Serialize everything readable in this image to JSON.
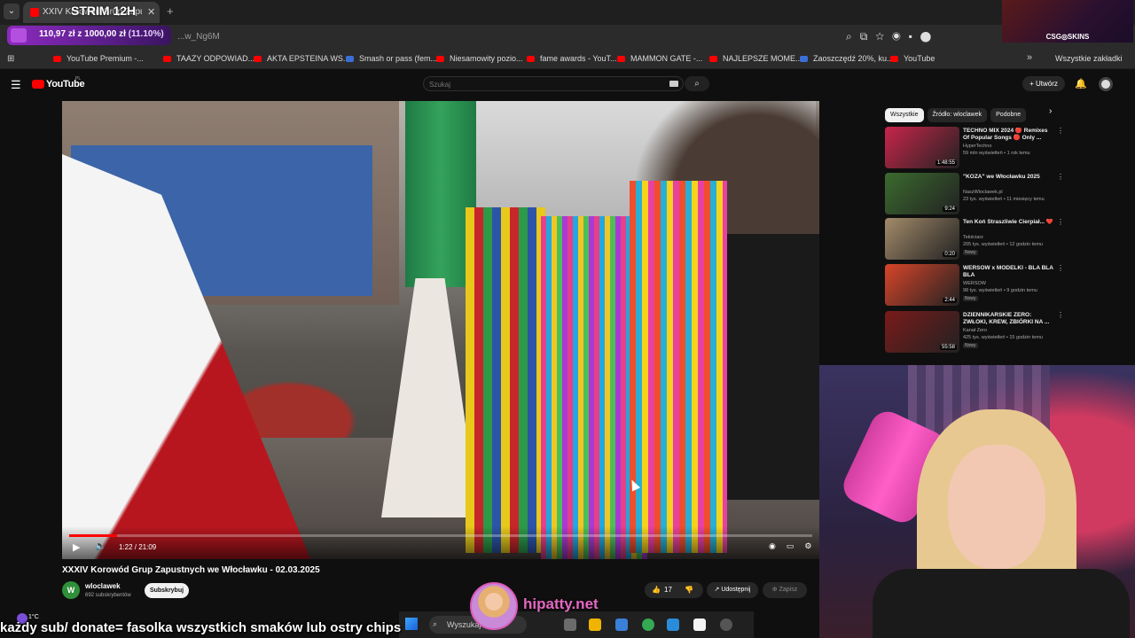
{
  "browser": {
    "tab_title": "XXIV Korowód Grup Zapustnych...",
    "stream_title": "STRIM 12H",
    "url": "...w_Ng6M",
    "bookmarks": [
      "YouTube Premium -...",
      "TAAZY ODPOWIAD...",
      "AKTA EPSTEINA WS...",
      "Smash or pass (fem...",
      "Niesamowity pozio...",
      "fame awards - YouT...",
      "MAMMON GATE -...",
      "NAJLEPSZE MOME...",
      "Zaoszczędź 20%, ku...",
      "YouTube"
    ],
    "all_bookmarks": "Wszystkie zakładki"
  },
  "donation": {
    "amount": "110,97 zł",
    "sep": "z",
    "goal": "1000,00 zł",
    "percent": "(11.10%)",
    "progress": 0.111
  },
  "csg_overlay": "CSG◎SKINS",
  "youtube": {
    "logo": "YouTube",
    "logo_region": "PL",
    "search_placeholder": "Szukaj",
    "create_label": "Utwórz"
  },
  "player": {
    "time": "1:22 / 21:09",
    "progress": 0.065
  },
  "video": {
    "title": "XXXIV Korowód Grup Zapustnych we Włocławku - 02.03.2025",
    "channel": "wloclawek",
    "channel_initial": "W",
    "subscribers": "692 subskrybentów",
    "subscribe_label": "Subskrybuj",
    "likes": "17",
    "share_label": "Udostępnij",
    "save_label": "Zapisz"
  },
  "sidebar": {
    "chips": [
      "Wszystkie",
      "Źródło: wloclawek",
      "Podobne"
    ],
    "recommendations": [
      {
        "title": "TECHNO MIX 2024 🔴 Remixes Of Popular Songs 🔴 Only ...",
        "channel": "HyperTechno",
        "meta": "59 mln wyświetleń • 1 rok temu",
        "duration": "1:48:55",
        "badge": "",
        "thumb_color": "#c8254a"
      },
      {
        "title": "\"KOZA\" we Włocławku 2025",
        "channel": "NaszWloclawek.pl",
        "meta": "23 tys. wyświetleń • 11 miesięcy temu",
        "duration": "9:24",
        "badge": "",
        "thumb_color": "#3b6a2e"
      },
      {
        "title": "Ten Koń Straszliwie Cierpiał... ❤️",
        "channel": "Tekściarz",
        "meta": "205 tys. wyświetleń • 12 godzin temu",
        "duration": "0:20",
        "badge": "Nowy",
        "thumb_color": "#a38b6a"
      },
      {
        "title": "WERSOW x MODELKI - BLA BLA BLA",
        "channel": "WERSOW",
        "meta": "98 tys. wyświetleń • 9 godzin temu",
        "duration": "2:44",
        "badge": "Nowy",
        "thumb_color": "#d8452a"
      },
      {
        "title": "DZIENNIKARSKIE ZERO: ZWŁOKI, KREW, ZBIÓRKI NA ...",
        "channel": "Kanał Zero",
        "meta": "425 tys. wyświetleń • 15 godzin temu",
        "duration": "55:58",
        "badge": "Nowy",
        "thumb_color": "#7a1a1a"
      }
    ]
  },
  "taskbar": {
    "search_label": "Wyszukaj",
    "weather": "1°C"
  },
  "overlay": {
    "ticker": "każdy sub/ donate= fasolka wszystkich smaków lub ostry chips",
    "site": "hipatty.net"
  }
}
